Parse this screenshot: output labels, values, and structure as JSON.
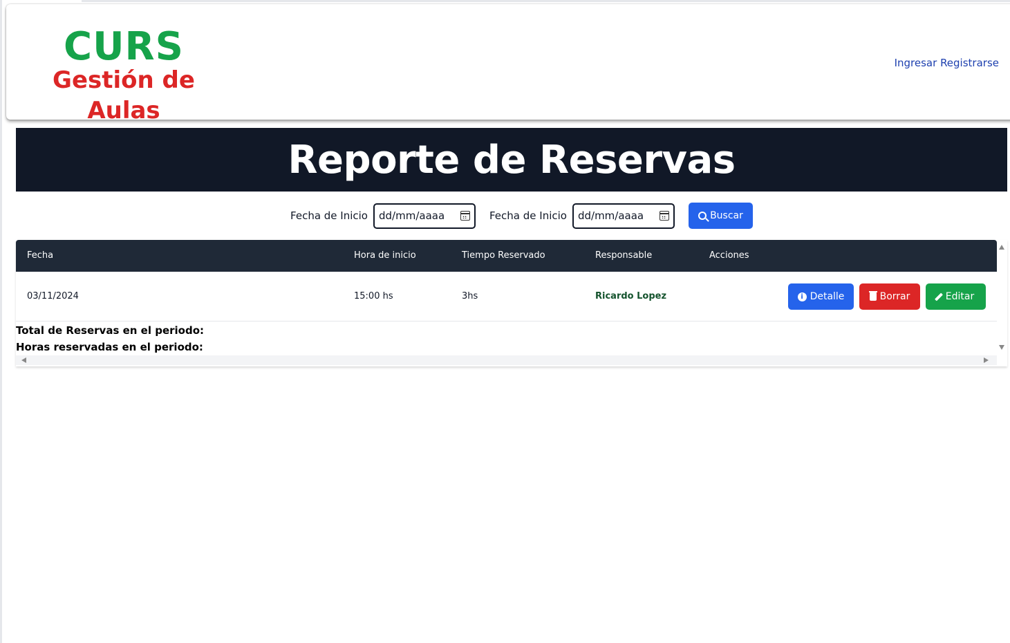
{
  "brand": {
    "title": "CURS",
    "subtitle": "Gestión de Aulas",
    "title_color": "#16a34a",
    "subtitle_color": "#dc2626"
  },
  "nav": {
    "login": "Ingresar",
    "register": "Registrarse"
  },
  "page": {
    "heading": "Reporte de Reservas"
  },
  "filters": {
    "start_label": "Fecha de Inicio",
    "start_placeholder": "dd/mm/aaaa",
    "end_label": "Fecha de Inicio",
    "end_placeholder": "dd/mm/aaaa",
    "search_button": "Buscar"
  },
  "table": {
    "columns": [
      "Fecha",
      "Hora de inicio",
      "Tiempo Reservado",
      "Responsable",
      "Acciones"
    ],
    "rows": [
      {
        "fecha": "03/11/2024",
        "hora": "15:00 hs",
        "tiempo": "3hs",
        "responsable": "Ricardo Lopez",
        "actions": [
          "Detalle",
          "Borrar",
          "Editar"
        ]
      }
    ]
  },
  "summary": {
    "total_label": "Total de Reservas en el periodo:",
    "hours_label": "Horas reservadas en el periodo:"
  },
  "colors": {
    "primary": "#2563eb",
    "danger": "#dc2626",
    "success": "#16a34a",
    "dark_header": "#111827"
  }
}
